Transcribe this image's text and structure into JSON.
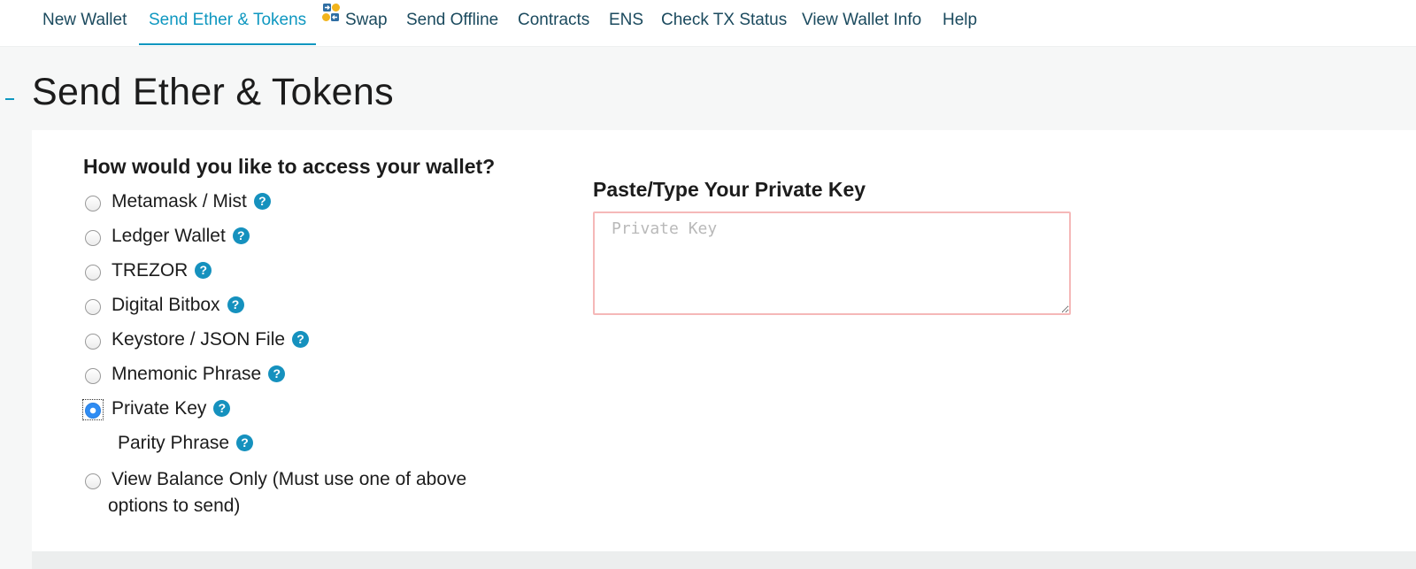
{
  "nav": {
    "items": [
      {
        "label": "New Wallet",
        "icon": null,
        "active": false
      },
      {
        "label": "Send Ether & Tokens",
        "icon": null,
        "active": true
      },
      {
        "label": "Swap",
        "icon": "swap-icon",
        "active": false
      },
      {
        "label": "Send Offline",
        "icon": null,
        "active": false
      },
      {
        "label": "Contracts",
        "icon": null,
        "active": false
      },
      {
        "label": "ENS",
        "icon": null,
        "active": false
      },
      {
        "label": "Check TX Status",
        "icon": null,
        "active": false
      },
      {
        "label": "View Wallet Info",
        "icon": null,
        "active": false
      },
      {
        "label": "Help",
        "icon": null,
        "active": false
      }
    ]
  },
  "page": {
    "title": "Send Ether & Tokens"
  },
  "access": {
    "heading": "How would you like to access your wallet?",
    "options": [
      {
        "label": "Metamask / Mist",
        "checked": false,
        "help_icon": "question-icon"
      },
      {
        "label": "Ledger Wallet",
        "checked": false,
        "help_icon": "question-icon"
      },
      {
        "label": "TREZOR",
        "checked": false,
        "help_icon": "question-icon"
      },
      {
        "label": "Digital Bitbox",
        "checked": false,
        "help_icon": "question-icon"
      },
      {
        "label": "Keystore / JSON File",
        "checked": false,
        "help_icon": "question-icon"
      },
      {
        "label": "Mnemonic Phrase",
        "checked": false,
        "help_icon": "question-icon"
      },
      {
        "label": "Private Key",
        "checked": true,
        "help_icon": "question-icon"
      },
      {
        "label": "Parity Phrase",
        "checked": false,
        "help_icon": "question-icon"
      }
    ],
    "view_balance": {
      "line1": "View Balance Only (Must use one of above",
      "line2": "options to send)",
      "checked": false
    },
    "help_glyph": "?"
  },
  "private_key": {
    "heading": "Paste/Type Your Private Key",
    "placeholder": "Private Key",
    "value": ""
  },
  "colors": {
    "accent": "#0e97c0",
    "nav_text": "#1b4a5e",
    "help_badge": "#1591be",
    "input_border_invalid": "#f5b8b8",
    "radio_checked": "#2f8cf3"
  }
}
